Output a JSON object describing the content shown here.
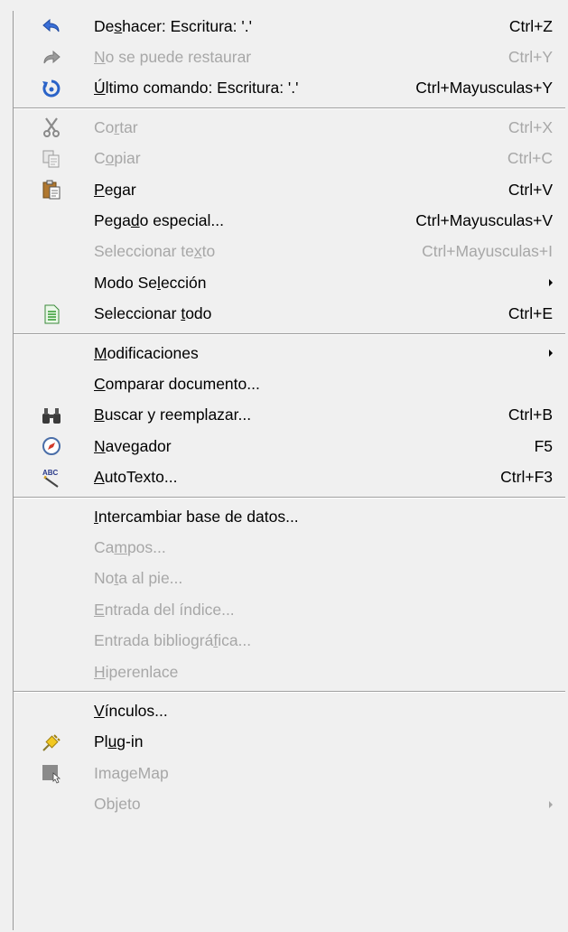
{
  "menu": {
    "groups": [
      [
        {
          "id": "undo",
          "pre": "De",
          "u": "s",
          "post": "hacer: Escritura: '.'",
          "shortcut": "Ctrl+Z",
          "disabled": false,
          "icon": "undo-icon"
        },
        {
          "id": "redo",
          "pre": "",
          "u": "N",
          "post": "o se puede restaurar",
          "shortcut": "Ctrl+Y",
          "disabled": true,
          "icon": "redo-icon"
        },
        {
          "id": "repeat",
          "pre": "",
          "u": "Ú",
          "post": "ltimo comando: Escritura: '.'",
          "shortcut": "Ctrl+Mayusculas+Y",
          "disabled": false,
          "icon": "repeat-icon"
        }
      ],
      [
        {
          "id": "cut",
          "pre": "Co",
          "u": "r",
          "post": "tar",
          "shortcut": "Ctrl+X",
          "disabled": true,
          "icon": "cut-icon"
        },
        {
          "id": "copy",
          "pre": "C",
          "u": "o",
          "post": "piar",
          "shortcut": "Ctrl+C",
          "disabled": true,
          "icon": "copy-icon"
        },
        {
          "id": "paste",
          "pre": "",
          "u": "P",
          "post": "egar",
          "shortcut": "Ctrl+V",
          "disabled": false,
          "icon": "paste-icon"
        },
        {
          "id": "paste-special",
          "pre": "Pega",
          "u": "d",
          "post": "o especial...",
          "shortcut": "Ctrl+Mayusculas+V",
          "disabled": false,
          "icon": ""
        },
        {
          "id": "select-text",
          "pre": "Seleccionar te",
          "u": "x",
          "post": "to",
          "shortcut": "Ctrl+Mayusculas+I",
          "disabled": true,
          "icon": ""
        },
        {
          "id": "selection-mode",
          "pre": "Modo Se",
          "u": "l",
          "post": "ección",
          "shortcut": "",
          "submenu": true,
          "disabled": false,
          "icon": ""
        },
        {
          "id": "select-all",
          "pre": "Seleccionar ",
          "u": "t",
          "post": "odo",
          "shortcut": "Ctrl+E",
          "disabled": false,
          "icon": "select-all-icon"
        }
      ],
      [
        {
          "id": "changes",
          "pre": "",
          "u": "M",
          "post": "odificaciones",
          "shortcut": "",
          "submenu": true,
          "disabled": false,
          "icon": ""
        },
        {
          "id": "compare",
          "pre": "",
          "u": "C",
          "post": "omparar documento...",
          "shortcut": "",
          "disabled": false,
          "icon": ""
        },
        {
          "id": "find-replace",
          "pre": "",
          "u": "B",
          "post": "uscar y reemplazar...",
          "shortcut": "Ctrl+B",
          "disabled": false,
          "icon": "binoculars-icon"
        },
        {
          "id": "navigator",
          "pre": "",
          "u": "N",
          "post": "avegador",
          "shortcut": "F5",
          "disabled": false,
          "icon": "compass-icon"
        },
        {
          "id": "autotext",
          "pre": "",
          "u": "A",
          "post": "utoTexto...",
          "shortcut": "Ctrl+F3",
          "disabled": false,
          "icon": "autotext-icon"
        }
      ],
      [
        {
          "id": "exchange-db",
          "pre": "",
          "u": "I",
          "post": "ntercambiar base de datos...",
          "shortcut": "",
          "disabled": false,
          "icon": ""
        },
        {
          "id": "fields",
          "pre": "Ca",
          "u": "m",
          "post": "pos...",
          "shortcut": "",
          "disabled": true,
          "icon": ""
        },
        {
          "id": "footnote",
          "pre": "No",
          "u": "t",
          "post": "a al pie...",
          "shortcut": "",
          "disabled": true,
          "icon": ""
        },
        {
          "id": "index-entry",
          "pre": "",
          "u": "E",
          "post": "ntrada del índice...",
          "shortcut": "",
          "disabled": true,
          "icon": ""
        },
        {
          "id": "bib-entry",
          "pre": "Entrada bibliográ",
          "u": "f",
          "post": "ica...",
          "shortcut": "",
          "disabled": true,
          "icon": ""
        },
        {
          "id": "hyperlink",
          "pre": "",
          "u": "H",
          "post": "iperenlace",
          "shortcut": "",
          "disabled": true,
          "icon": ""
        }
      ],
      [
        {
          "id": "links",
          "pre": "",
          "u": "V",
          "post": "ínculos...",
          "shortcut": "",
          "disabled": false,
          "icon": ""
        },
        {
          "id": "plugin",
          "pre": "Pl",
          "u": "u",
          "post": "g-in",
          "shortcut": "",
          "disabled": false,
          "icon": "plugin-icon"
        },
        {
          "id": "imagemap",
          "pre": "Ima",
          "u": "g",
          "post": "eMap",
          "shortcut": "",
          "disabled": true,
          "icon": "imagemap-icon"
        },
        {
          "id": "object",
          "pre": "Objeto",
          "u": "",
          "post": "",
          "shortcut": "",
          "submenu": true,
          "disabled": true,
          "icon": ""
        }
      ]
    ]
  }
}
